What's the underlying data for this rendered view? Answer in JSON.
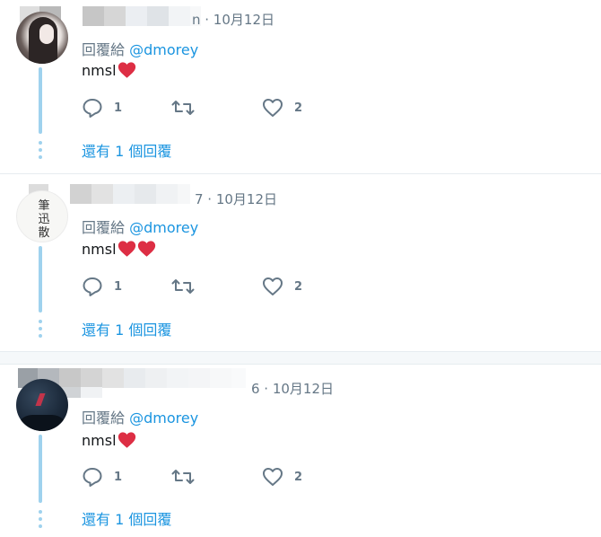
{
  "tweets": [
    {
      "timestamp": "n · 10月12日",
      "reply_prefix": "回覆給",
      "reply_handle": "@dmorey",
      "body": "nmsl",
      "heart_emojis": 1,
      "reply_count": "1",
      "like_count": "2",
      "more_replies": "還有 1 個回覆"
    },
    {
      "timestamp": "7 · 10月12日",
      "reply_prefix": "回覆給",
      "reply_handle": "@dmorey",
      "body": "nmsl",
      "heart_emojis": 2,
      "reply_count": "1",
      "like_count": "2",
      "more_replies": "還有 1 個回覆",
      "avatar_text": "筆\n迅\n散"
    },
    {
      "timestamp": "6 · 10月12日",
      "reply_prefix": "回覆給",
      "reply_handle": "@dmorey",
      "body": "nmsl",
      "heart_emojis": 1,
      "reply_count": "1",
      "like_count": "2",
      "more_replies": "還有 1 個回覆"
    }
  ],
  "icons": {
    "reply": "reply-icon",
    "retweet": "retweet-icon",
    "like": "heart-outline-icon",
    "emoji": "red-heart-emoji"
  },
  "colors": {
    "link": "#1b95e0",
    "secondary_text": "#657786",
    "thread_line": "#9fd2ee",
    "heart_emoji": "#dd2e44"
  }
}
